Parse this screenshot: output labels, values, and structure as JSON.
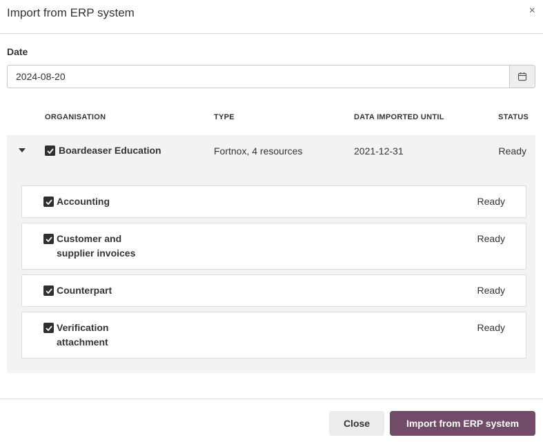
{
  "dialog": {
    "title": "Import from ERP system",
    "close_symbol": "×"
  },
  "date": {
    "label": "Date",
    "value": "2024-08-20"
  },
  "table": {
    "headers": {
      "organisation": "ORGANISATION",
      "type": "TYPE",
      "imported_until": "DATA IMPORTED UNTIL",
      "status": "STATUS"
    },
    "org": {
      "name": "Boardeaser Education",
      "checked": true,
      "type": "Fortnox, 4 resources",
      "imported_until": "2021-12-31",
      "status": "Ready"
    },
    "resources": [
      {
        "label": "Accounting",
        "status": "Ready",
        "checked": true
      },
      {
        "label": "Customer and supplier invoices",
        "status": "Ready",
        "checked": true
      },
      {
        "label": "Counterpart",
        "status": "Ready",
        "checked": true
      },
      {
        "label": "Verification attachment",
        "status": "Ready",
        "checked": true
      }
    ]
  },
  "footer": {
    "close_label": "Close",
    "import_label": "Import from ERP system"
  },
  "colors": {
    "primary": "#714b67",
    "panel": "#f3f3f3"
  }
}
